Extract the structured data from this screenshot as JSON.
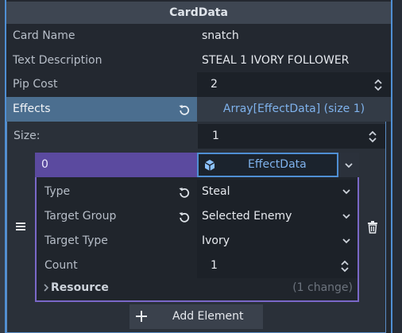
{
  "header": {
    "title": "CardData"
  },
  "fields": {
    "card_name": {
      "label": "Card Name",
      "value": "snatch"
    },
    "text_description": {
      "label": "Text Description",
      "value": "STEAL 1 IVORY FOLLOWER"
    },
    "pip_cost": {
      "label": "Pip Cost",
      "value": "2"
    }
  },
  "effects": {
    "label": "Effects",
    "array_label": "Array[EffectData] (size 1)",
    "size_label": "Size:",
    "size_value": "1",
    "element": {
      "index": "0",
      "resource_type": "EffectData",
      "type": {
        "label": "Type",
        "value": "Steal"
      },
      "target_group": {
        "label": "Target Group",
        "value": "Selected Enemy"
      },
      "target_type": {
        "label": "Target Type",
        "value": "Ivory"
      },
      "count": {
        "label": "Count",
        "value": "1"
      },
      "resource": {
        "label": "Resource",
        "changes": "(1 change)"
      }
    },
    "add_element_label": "Add Element"
  },
  "colors": {
    "accent_blue": "#4f8fd4",
    "effects_highlight": "#4b6e8f",
    "element_purple": "#5b4a9f",
    "link_text": "#7fb2ec"
  }
}
